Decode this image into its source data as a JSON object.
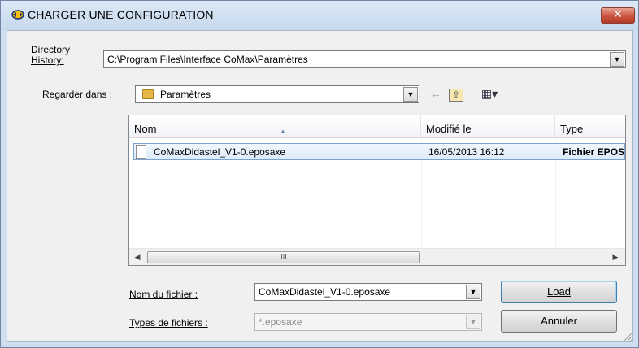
{
  "window": {
    "title": "CHARGER UNE CONFIGURATION",
    "close_glyph": "✕"
  },
  "directory_history": {
    "label_line1": "Directory",
    "label_line2": "History:",
    "value": "C:\\Program Files\\Interface CoMax\\Paramètres"
  },
  "look_in": {
    "label": "Regarder dans :",
    "value": "Paramètres"
  },
  "toolbar": {
    "back_glyph": "←",
    "up_glyph": "⇧",
    "views_glyph": "▦▾"
  },
  "file_list": {
    "columns": [
      "Nom",
      "Modifié le",
      "Type"
    ],
    "rows": [
      {
        "name": "CoMaxDidastel_V1-0.eposaxe",
        "modified": "16/05/2013 16:12",
        "type": "Fichier EPOSAXE"
      }
    ],
    "scroll_glyphs": {
      "left": "◀",
      "right": "▶",
      "thumb": "III"
    }
  },
  "file_name": {
    "label": "Nom du fichier :",
    "value": "CoMaxDidastel_V1-0.eposaxe"
  },
  "file_types": {
    "label": "Types de fichiers :",
    "value": "*.eposaxe"
  },
  "buttons": {
    "load": "Load",
    "cancel": "Annuler"
  },
  "colors": {
    "title_bar": "#c6d9ee",
    "close": "#c9543f",
    "selection": "#dcebfc"
  }
}
